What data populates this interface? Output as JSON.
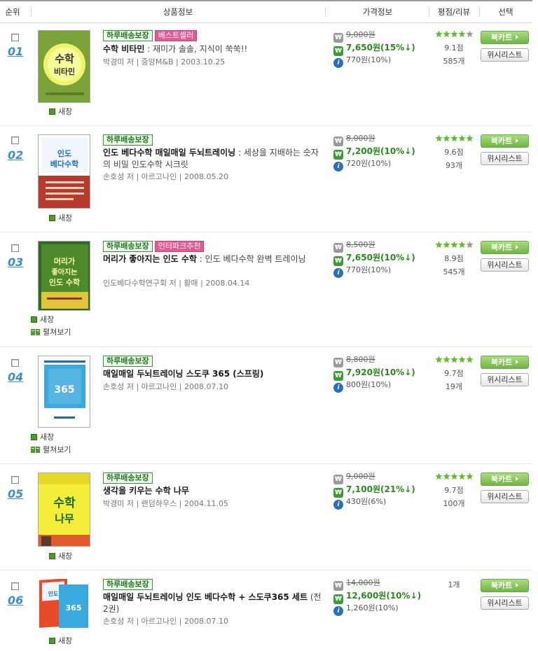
{
  "header": {
    "rank": "순위",
    "product": "상품정보",
    "price": "가격정보",
    "rating": "평점/리뷰",
    "select": "선택"
  },
  "labels": {
    "new_window": "새창",
    "preview": "펼쳐보기",
    "cart": "북카트",
    "wishlist": "위시리스트",
    "badge_delivery": "하루배송보장"
  },
  "price_icons": {
    "list": "won-gray-icon",
    "sale": "won-green-icon",
    "points": "info-icon"
  },
  "colors": {
    "sale": "#2a8a1e",
    "rank": "#3a90c8",
    "badge_green": "#2b9a2b",
    "badge_pink": "#e35a92",
    "star": "#5cbf2a"
  },
  "rows": [
    {
      "rank": "01",
      "badges": [
        "하루배송보장",
        "베스트셀러"
      ],
      "title": "수학 비타민",
      "subtitle": " : 재미가 솔솔, 지식이 쑥쑥!!",
      "meta": "박경미 저 | 중앙M&B | 2003.10.25",
      "list_price": "9,000원",
      "sale_price": "7,650원(15%↓)",
      "points": "770원(10%)",
      "stars": 4,
      "score": "9.1점",
      "reviews": "585개",
      "preview": false
    },
    {
      "rank": "02",
      "badges": [
        "하루배송보장"
      ],
      "title": "인도 베다수학 매일매일 두뇌트레이닝",
      "subtitle": " : 세상을 지배하는 숫자의 비밀 인도수학 시크릿",
      "meta": "손호성 저 | 아르고나인 | 2008.05.20",
      "list_price": "8,000원",
      "sale_price": "7,200원(10%↓)",
      "points": "720원(10%)",
      "stars": 5,
      "score": "9.6점",
      "reviews": "93개",
      "preview": false
    },
    {
      "rank": "03",
      "badges": [
        "하루배송보장",
        "인터파크추천"
      ],
      "title": "머리가 좋아지는 인도 수학",
      "subtitle": " : 인도 베다수학 완벽 트레이닝",
      "meta": "인도베다수학연구회 저 | 황매 | 2008.04.14",
      "list_price": "8,500원",
      "sale_price": "7,650원(10%↓)",
      "points": "770원(10%)",
      "stars": 4,
      "score": "8.9점",
      "reviews": "545개",
      "preview": true
    },
    {
      "rank": "04",
      "badges": [
        "하루배송보장"
      ],
      "title": "매일매일 두뇌트레이닝 스도쿠 365 (스프링)",
      "subtitle": "",
      "meta": "손호성 저 | 아르고나인 | 2008.07.10",
      "list_price": "8,800원",
      "sale_price": "7,920원(10%↓)",
      "points": "800원(10%)",
      "stars": 5,
      "score": "9.7점",
      "reviews": "19개",
      "preview": true
    },
    {
      "rank": "05",
      "badges": [
        "하루배송보장"
      ],
      "title": "생각을 키우는 수학 나무",
      "subtitle": "",
      "meta": "박경미 저 | 랜덤하우스 | 2004.11.05",
      "list_price": "9,000원",
      "sale_price": "7,100원(21%↓)",
      "points": "430원(6%)",
      "stars": 5,
      "score": "9.7점",
      "reviews": "100개",
      "preview": false
    },
    {
      "rank": "06",
      "badges": [
        "하루배송보장"
      ],
      "title": "매일매일 두뇌트레이닝 인도 베다수학 + 스도쿠365 세트",
      "subtitle": " (전2권)",
      "meta": "손호성 저 | 아르고나인 | 2008.07.10",
      "list_price": "14,000원",
      "sale_price": "12,600원(10%↓)",
      "points": "1,260원(10%)",
      "stars": 0,
      "score": "",
      "reviews": "1개",
      "preview": false
    }
  ]
}
